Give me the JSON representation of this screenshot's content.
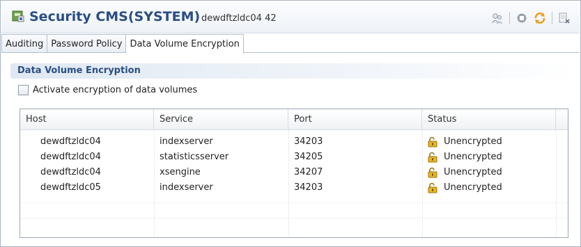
{
  "header": {
    "title": "Security CMS(SYSTEM)",
    "subtitle": "dewdftzldc04 42"
  },
  "toolbar_icons": [
    "users-icon",
    "stop-icon",
    "refresh-icon",
    "close-editor-icon"
  ],
  "tabs": [
    {
      "label": "Auditing",
      "active": false
    },
    {
      "label": "Password Policy",
      "active": false
    },
    {
      "label": "Data Volume Encryption",
      "active": true
    }
  ],
  "section": {
    "title": "Data Volume Encryption",
    "checkbox_label": "Activate encryption of data volumes",
    "checkbox_checked": false
  },
  "table": {
    "columns": [
      "Host",
      "Service",
      "Port",
      "Status"
    ],
    "rows": [
      {
        "host": "dewdftzldc04",
        "service": "indexserver",
        "port": "34203",
        "status": "Unencrypted"
      },
      {
        "host": "dewdftzldc04",
        "service": "statisticsserver",
        "port": "34205",
        "status": "Unencrypted"
      },
      {
        "host": "dewdftzldc04",
        "service": "xsengine",
        "port": "34207",
        "status": "Unencrypted"
      },
      {
        "host": "dewdftzldc05",
        "service": "indexserver",
        "port": "34203",
        "status": "Unencrypted"
      }
    ]
  },
  "colors": {
    "title": "#2a4e83",
    "lock": "#e8b526"
  }
}
